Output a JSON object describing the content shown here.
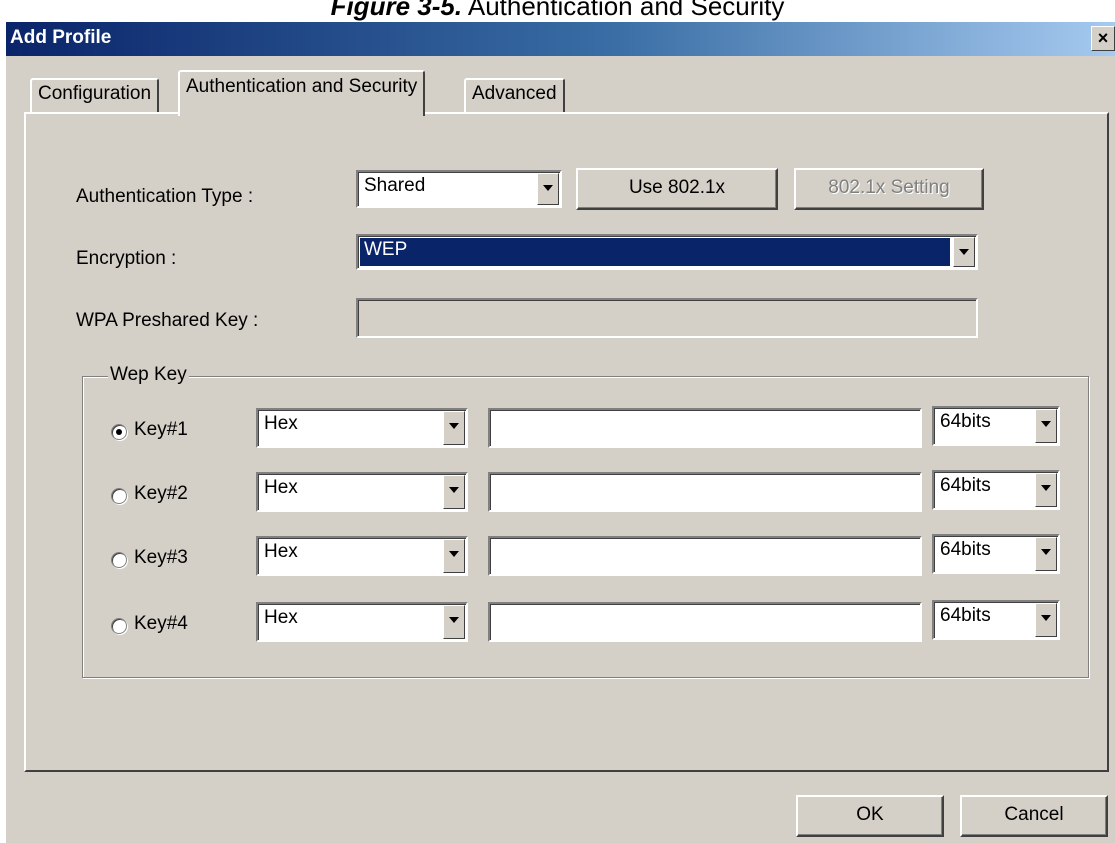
{
  "caption": {
    "number": "Figure 3-5.",
    "text": "Authentication and Security"
  },
  "window": {
    "title": "Add Profile",
    "close_label": "×"
  },
  "tabs": [
    {
      "label": "Configuration"
    },
    {
      "label": "Authentication and Security",
      "active": true
    },
    {
      "label": "Advanced"
    }
  ],
  "auth": {
    "type_label": "Authentication Type :",
    "type_value": "Shared",
    "use_8021x_label": "Use 802.1x",
    "setting_8021x_label": "802.1x Setting",
    "encryption_label": "Encryption :",
    "encryption_value": "WEP",
    "wpa_label": "WPA Preshared Key :",
    "wpa_value": ""
  },
  "wep": {
    "group_label": "Wep Key",
    "keys": [
      {
        "label": "Key#1",
        "format": "Hex",
        "value": "",
        "length": "64bits",
        "selected": true
      },
      {
        "label": "Key#2",
        "format": "Hex",
        "value": "",
        "length": "64bits",
        "selected": false
      },
      {
        "label": "Key#3",
        "format": "Hex",
        "value": "",
        "length": "64bits",
        "selected": false
      },
      {
        "label": "Key#4",
        "format": "Hex",
        "value": "",
        "length": "64bits",
        "selected": false
      }
    ]
  },
  "footer": {
    "ok_label": "OK",
    "cancel_label": "Cancel"
  },
  "colors": {
    "titlebar": "#0a246a",
    "face": "#d4d0c8",
    "selection": "#0a246a"
  }
}
